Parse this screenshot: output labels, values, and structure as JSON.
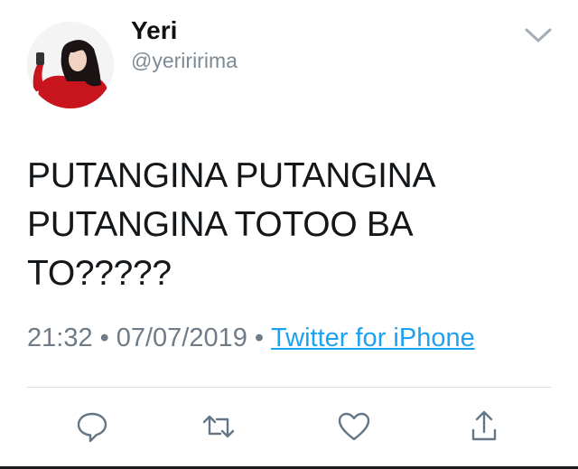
{
  "tweet": {
    "author": {
      "display_name": "Yeri",
      "handle": "@yeriririma"
    },
    "text_lines": [
      "PUTANGINA PUTANGINA",
      "PUTANGINA TOTOO BA",
      "TO?????"
    ],
    "time": "21:32",
    "separator": "•",
    "date": "07/07/2019",
    "source": "Twitter for iPhone"
  },
  "icons": {
    "menu": "chevron-down-icon",
    "reply": "comment-bubble-icon",
    "retweet": "retweet-arrows-icon",
    "like": "heart-icon",
    "share": "share-upload-icon"
  },
  "colors": {
    "link": "#1da1f2",
    "muted": "#6f7c87",
    "icon": "#657786",
    "divider": "#d6dce0"
  }
}
